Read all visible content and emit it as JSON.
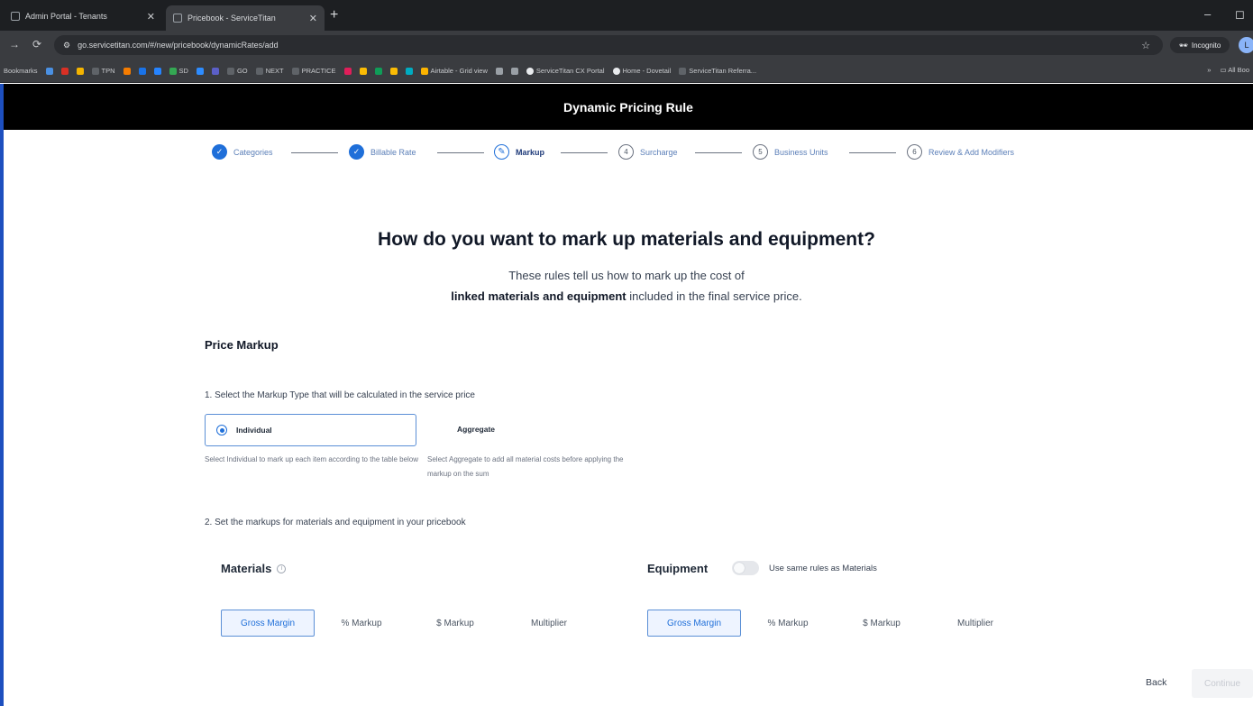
{
  "browser": {
    "tabs": [
      {
        "title": "Admin Portal - Tenants",
        "active": false
      },
      {
        "title": "Pricebook - ServiceTitan",
        "active": true
      }
    ],
    "new_tab": "+",
    "minimize": "–",
    "restore": "◻",
    "url": "go.servicetitan.com/#/new/pricebook/dynamicRates/add",
    "incognito_label": "Incognito",
    "profile_initial": "L",
    "bookmarks_label": "Bookmarks",
    "bookmarks": [
      "TPN",
      "SD",
      "GO",
      "NEXT",
      "PRACTICE",
      "Airtable - Grid view",
      "ServiceTitan CX Portal",
      "Home - Dovetail",
      "ServiceTitan Referra..."
    ],
    "all_bookmarks": "All Boo"
  },
  "app": {
    "title": "Dynamic Pricing Rule",
    "steps": [
      {
        "number": "1",
        "label": "Categories",
        "state": "done"
      },
      {
        "number": "2",
        "label": "Billable Rate",
        "state": "done"
      },
      {
        "number": "3",
        "label": "Markup",
        "state": "current"
      },
      {
        "number": "4",
        "label": "Surcharge",
        "state": "todo"
      },
      {
        "number": "5",
        "label": "Business Units",
        "state": "todo"
      },
      {
        "number": "6",
        "label": "Review & Add Modifiers",
        "state": "todo"
      }
    ],
    "headline": "How do you want to mark up materials and equipment?",
    "subtitle_line1": "These rules tell us how to mark up the cost of",
    "subtitle_bold": "linked materials and equipment",
    "subtitle_rest": " included in the final service price.",
    "section_title": "Price Markup",
    "question1": "1. Select the Markup Type that will be calculated in the service price",
    "markup_type_options": [
      {
        "label": "Individual",
        "selected": true,
        "description": "Select Individual to mark up each item according to the table below"
      },
      {
        "label": "Aggregate",
        "selected": false,
        "description": "Select Aggregate to add all material costs before applying the markup on the sum"
      }
    ],
    "question2": "2. Set the markups for materials and equipment in your pricebook",
    "materials": {
      "title": "Materials",
      "info_icon": "i",
      "options": [
        "Gross Margin",
        "% Markup",
        "$ Markup",
        "Multiplier"
      ],
      "selected": "Gross Margin"
    },
    "equipment": {
      "title": "Equipment",
      "toggle_label": "Use same rules as Materials",
      "toggle_on": false,
      "options": [
        "Gross Margin",
        "% Markup",
        "$ Markup",
        "Multiplier"
      ],
      "selected": "Gross Margin"
    },
    "back_label": "Back",
    "continue_label": "Continue"
  },
  "colors": {
    "accent": "#1f6fd9",
    "header_bg": "#000000",
    "chrome_bg": "#3a3c40"
  }
}
